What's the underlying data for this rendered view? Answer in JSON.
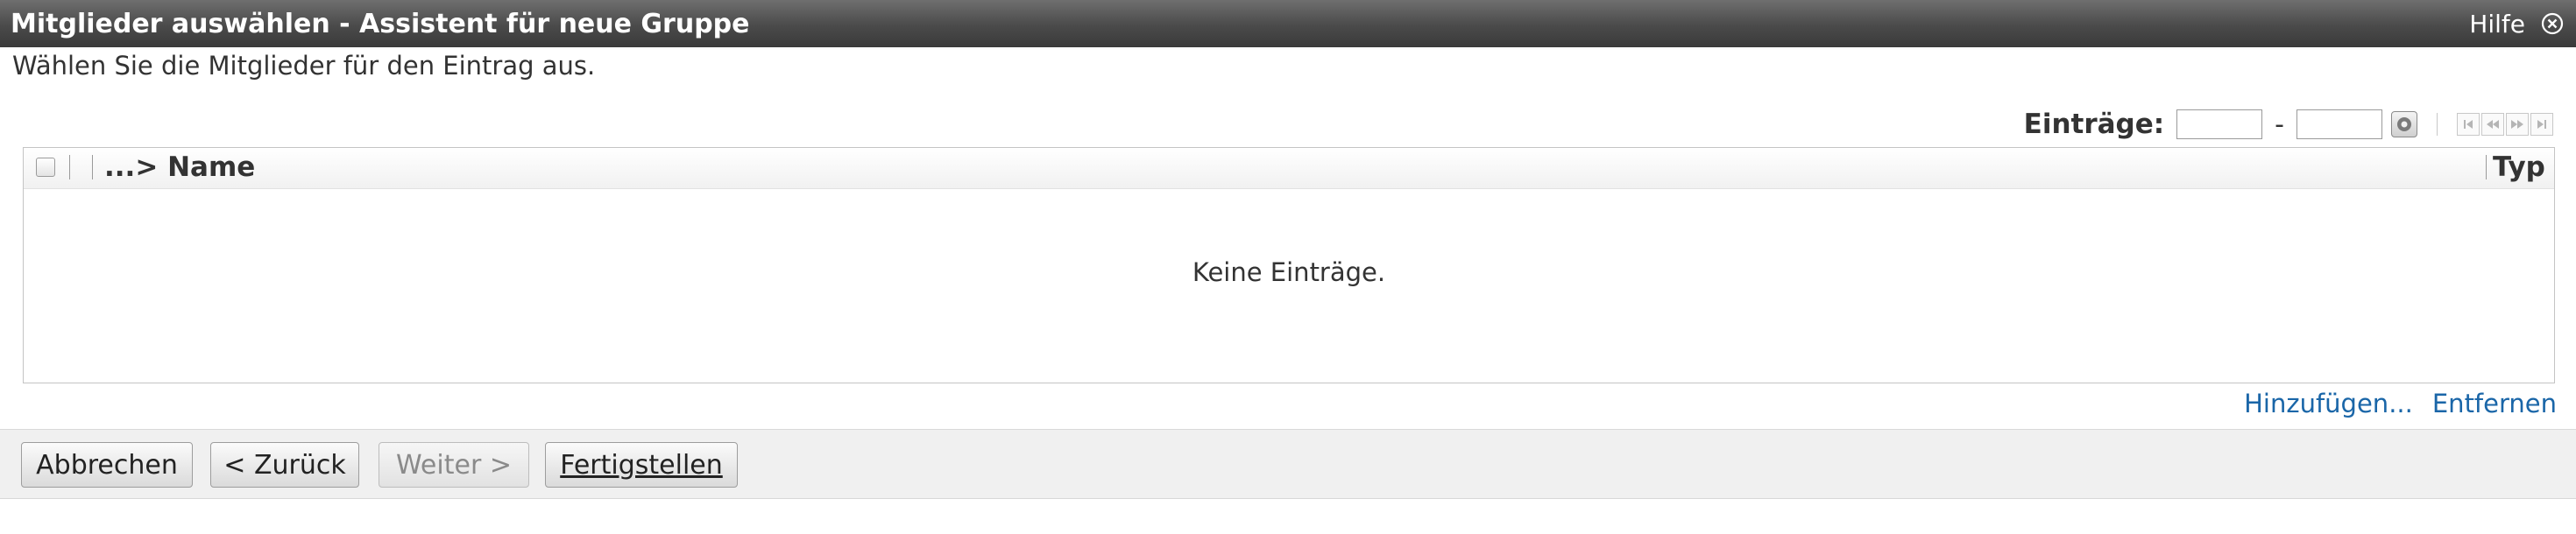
{
  "window": {
    "title": "Mitglieder auswählen - Assistent für neue Gruppe",
    "help_label": "Hilfe",
    "close_icon": "close-icon"
  },
  "description": "Wählen Sie die Mitglieder für den Eintrag aus.",
  "range": {
    "label": "Einträge:",
    "from_value": "",
    "separator": "-",
    "to_value": "",
    "go_icon": "go-icon",
    "pager_icons": [
      "first-page-icon",
      "previous-page-icon",
      "next-page-icon",
      "last-page-icon"
    ]
  },
  "table": {
    "columns": [
      {
        "label": "...> Name"
      },
      {
        "label": "Typ"
      }
    ],
    "rows": [],
    "empty_message": "Keine Einträge."
  },
  "links": {
    "add": "Hinzufügen...",
    "remove": "Entfernen"
  },
  "footer": {
    "cancel": "Abbrechen",
    "back": "< Zurück",
    "next": "Weiter >",
    "finish": "Fertigstellen"
  },
  "colors": {
    "titlebar": "#4a4a4a",
    "link": "#1a66a8",
    "footer_bg": "#f0f0f0"
  }
}
